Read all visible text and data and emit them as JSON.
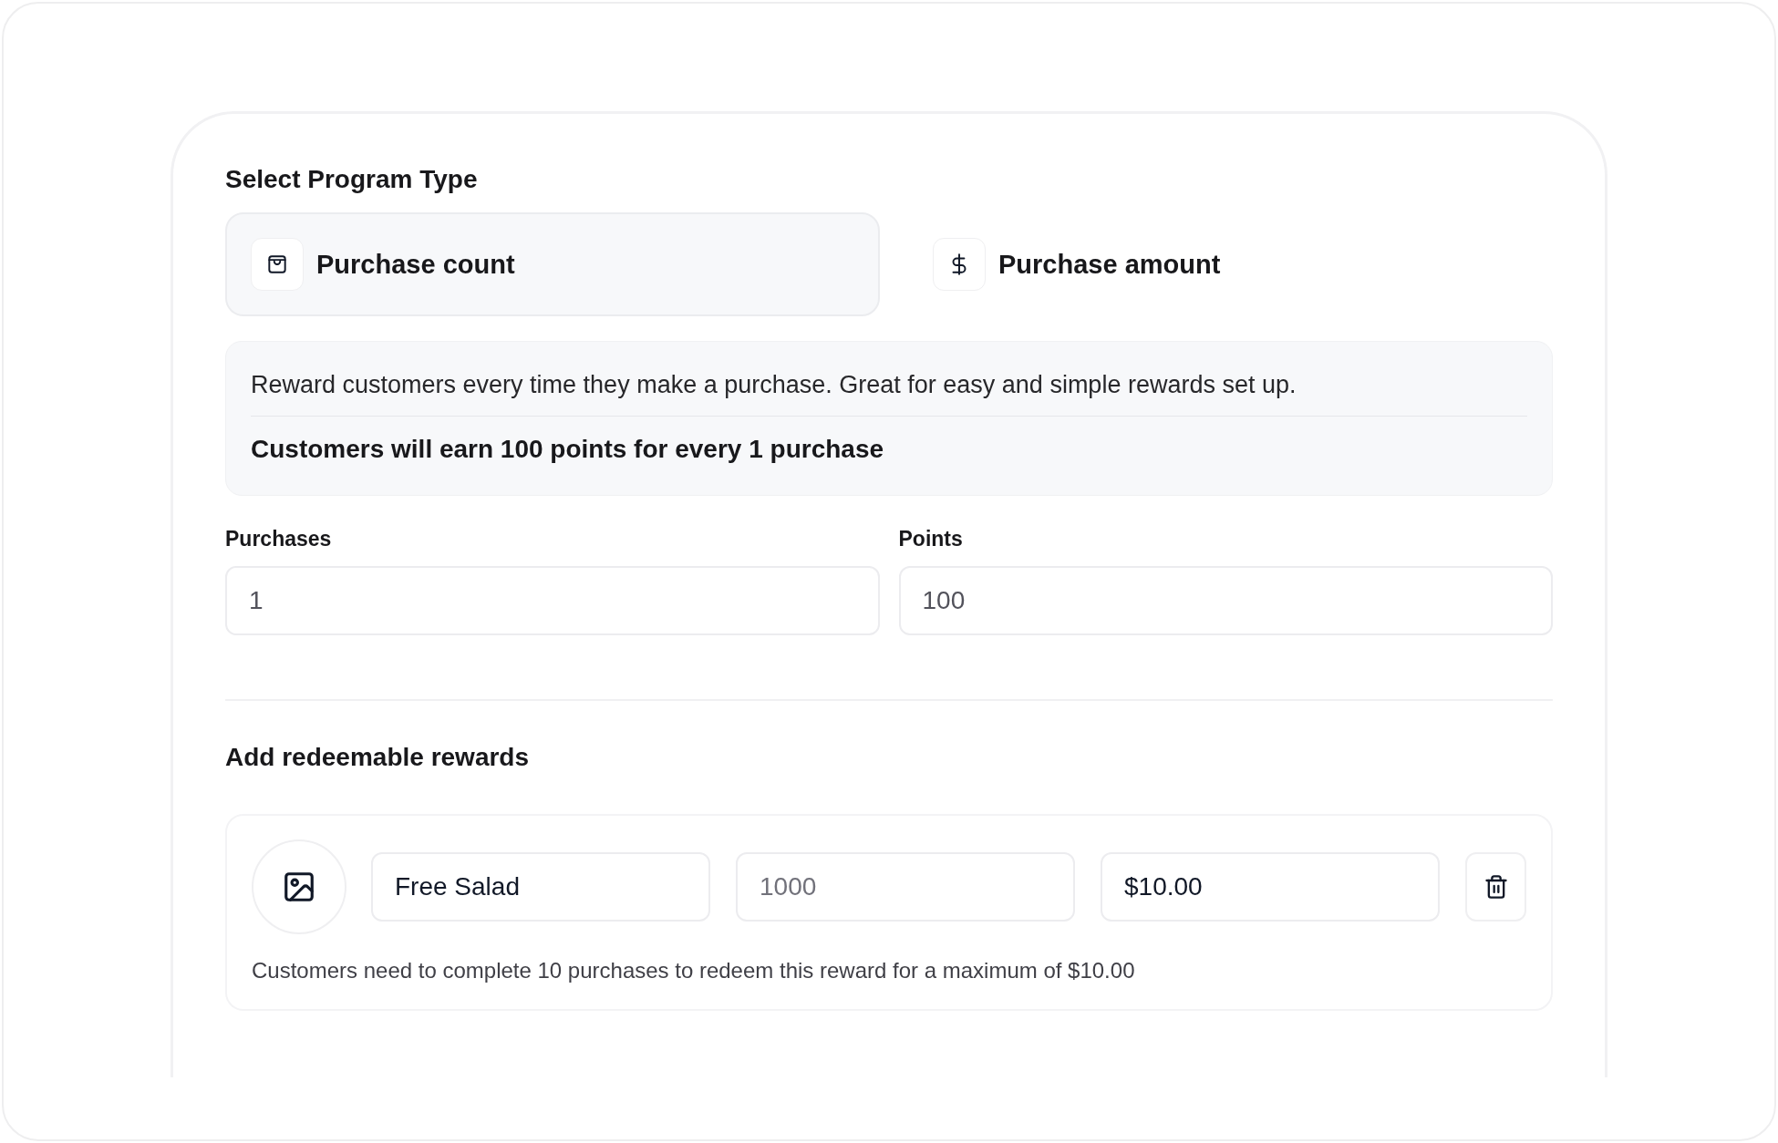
{
  "program_type": {
    "title": "Select Program Type",
    "options": [
      {
        "label": "Purchase count",
        "kind": "count",
        "selected": true
      },
      {
        "label": "Purchase amount",
        "kind": "amount",
        "selected": false
      }
    ],
    "description": "Reward customers every time they make a purchase. Great for easy and simple rewards set up.",
    "summary": "Customers will earn 100 points for every 1 purchase"
  },
  "fields": [
    {
      "label": "Purchases",
      "value": "1"
    },
    {
      "label": "Points",
      "value": "100"
    }
  ],
  "rewards": {
    "title": "Add redeemable rewards",
    "items": [
      {
        "name": "Free Salad",
        "points_placeholder": "1000",
        "max_value": "$10.00",
        "note": "Customers need to complete 10 purchases to redeem this reward for a maximum of $10.00"
      }
    ]
  }
}
